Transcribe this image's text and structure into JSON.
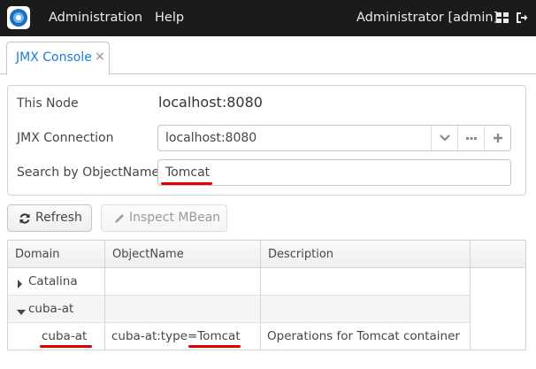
{
  "header": {
    "logo_icon": "cuba-logo-icon",
    "menu": [
      "Administration",
      "Help"
    ],
    "user": "Administrator [admin]",
    "icons": [
      "grid-icon",
      "logout-icon"
    ]
  },
  "tabs": [
    {
      "label": "JMX Console",
      "close": "×"
    }
  ],
  "form": {
    "node_caption": "This Node",
    "node_value": "localhost:8080",
    "connection_caption": "JMX Connection",
    "connection_value": "localhost:8080",
    "search_caption": "Search by ObjectName",
    "search_value": "Tomcat"
  },
  "toolbar": {
    "refresh_label": "Refresh",
    "inspect_label": "Inspect MBean"
  },
  "table": {
    "columns": [
      "Domain",
      "ObjectName",
      "Description"
    ],
    "rows": [
      {
        "domain": "Catalina",
        "object_name": "",
        "description": "",
        "expanded": false
      },
      {
        "domain": "cuba-at",
        "object_name": "",
        "description": "",
        "expanded": true
      },
      {
        "domain": "cuba-at",
        "object_name": "cuba-at:type=Tomcat",
        "description": "Operations for Tomcat container"
      }
    ]
  },
  "colors": {
    "topbar": "#1b1b1b",
    "accent": "#197de1",
    "highlight": "#dd0000"
  }
}
